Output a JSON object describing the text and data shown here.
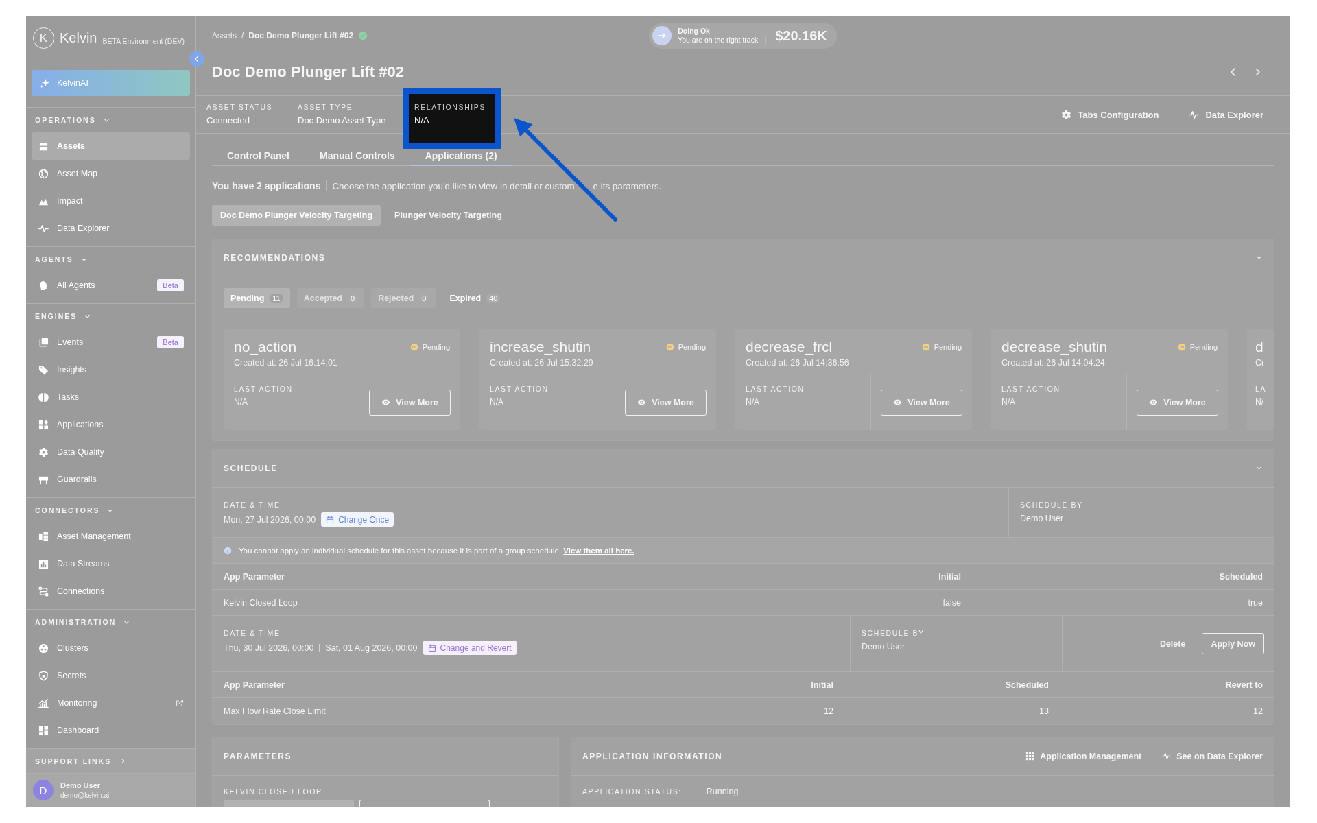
{
  "sidebar": {
    "logo_mark": "K",
    "logo": "Kelvin",
    "environment": "BETA Environment (DEV)",
    "ai_button": "KelvinAI",
    "sections": [
      {
        "title": "OPERATIONS",
        "expanded": true,
        "items": [
          {
            "label": "Assets",
            "selected": true
          },
          {
            "label": "Asset Map",
            "selected": false
          },
          {
            "label": "Impact",
            "selected": false
          },
          {
            "label": "Data Explorer",
            "selected": false
          }
        ]
      },
      {
        "title": "AGENTS",
        "expanded": true,
        "items": [
          {
            "label": "All Agents",
            "selected": false,
            "badge": "Beta"
          }
        ]
      },
      {
        "title": "ENGINES",
        "expanded": true,
        "items": [
          {
            "label": "Events",
            "selected": false,
            "badge": "Beta"
          },
          {
            "label": "Insights",
            "selected": false
          },
          {
            "label": "Tasks",
            "selected": false
          },
          {
            "label": "Applications",
            "selected": false
          },
          {
            "label": "Data Quality",
            "selected": false
          },
          {
            "label": "Guardrails",
            "selected": false
          }
        ]
      },
      {
        "title": "CONNECTORS",
        "expanded": true,
        "items": [
          {
            "label": "Asset Management",
            "selected": false
          },
          {
            "label": "Data Streams",
            "selected": false
          },
          {
            "label": "Connections",
            "selected": false
          }
        ]
      },
      {
        "title": "ADMINISTRATION",
        "expanded": true,
        "items": [
          {
            "label": "Clusters",
            "selected": false
          },
          {
            "label": "Secrets",
            "selected": false
          },
          {
            "label": "Monitoring",
            "selected": false,
            "external": true
          },
          {
            "label": "Dashboard",
            "selected": false
          }
        ]
      }
    ],
    "support_links": {
      "label": "SUPPORT LINKS",
      "expanded": false
    },
    "user": {
      "initial": "D",
      "name": "Demo User",
      "email": "demo@kelvin.ai"
    }
  },
  "header": {
    "breadcrumb": [
      {
        "label": "Assets"
      },
      {
        "label": "Doc Demo Plunger Lift #02"
      }
    ],
    "breadcrumb_separator": "/",
    "status": {
      "title": "Doing Ok",
      "subtitle": "You are on the right track",
      "value": "$20.16K"
    },
    "title": "Doc Demo Plunger Lift #02",
    "info": [
      {
        "label": "ASSET STATUS",
        "value": "Connected",
        "highlighted": false
      },
      {
        "label": "ASSET TYPE",
        "value": "Doc Demo Asset Type",
        "highlighted": false
      },
      {
        "label": "RELATIONSHIPS",
        "value": "N/A",
        "highlighted": true
      }
    ],
    "actions": [
      {
        "label": "Tabs Configuration",
        "kind": "config"
      },
      {
        "label": "Data Explorer",
        "kind": "explorer"
      }
    ],
    "tabs": [
      {
        "label": "Control Panel",
        "selected": false
      },
      {
        "label": "Manual Controls",
        "selected": false
      },
      {
        "label": "Applications (2)",
        "selected": true
      }
    ],
    "summary": "You have 2 applications",
    "hint": [
      "Choose the application you'd like to view in detail or custom",
      "e its parameters."
    ],
    "applications": [
      {
        "label": "Doc Demo Plunger Velocity Targeting",
        "selected": true
      },
      {
        "label": "Plunger Velocity Targeting",
        "selected": false
      }
    ]
  },
  "recommendations": {
    "title": "RECOMMENDATIONS",
    "expanded": true,
    "filters": [
      {
        "label": "Pending",
        "count": "11",
        "selected": true,
        "disabled": false
      },
      {
        "label": "Accepted",
        "count": "0",
        "selected": false,
        "disabled": true
      },
      {
        "label": "Rejected",
        "count": "0",
        "selected": false,
        "disabled": true
      },
      {
        "label": "Expired",
        "count": "40",
        "selected": false,
        "disabled": false
      }
    ],
    "cards": [
      {
        "title": "no_action",
        "status": "Pending",
        "created": "Created at: 26 Jul 16:14:01",
        "last_action_label": "LAST ACTION",
        "last_action": "N/A",
        "button": "View More"
      },
      {
        "title": "increase_shutin",
        "status": "Pending",
        "created": "Created at: 26 Jul 15:32:29",
        "last_action_label": "LAST ACTION",
        "last_action": "N/A",
        "button": "View More"
      },
      {
        "title": "decrease_frcl",
        "status": "Pending",
        "created": "Created at: 26 Jul 14:36:56",
        "last_action_label": "LAST ACTION",
        "last_action": "N/A",
        "button": "View More"
      },
      {
        "title": "decrease_shutin",
        "status": "Pending",
        "created": "Created at: 26 Jul 14:04:24",
        "last_action_label": "LAST ACTION",
        "last_action": "N/A",
        "button": "View More"
      },
      {
        "title": "d",
        "created": "Cr",
        "last_action_label": "LA",
        "last_action": "N/"
      }
    ]
  },
  "schedule": {
    "title": "SCHEDULE",
    "expanded": true,
    "items": [
      {
        "date_label": "DATE & TIME",
        "dates": [
          "Mon, 27 Jul 2026, 00:00"
        ],
        "change_button": {
          "label": "Change Once",
          "kind": "once"
        },
        "by_label": "SCHEDULE BY",
        "by": "Demo User",
        "notice": {
          "text": "You cannot apply an individual schedule for this asset because it is part of a group schedule.",
          "link": "View them all here."
        },
        "table": {
          "columns": [
            "App Parameter",
            "Initial",
            "Scheduled"
          ],
          "rows": [
            [
              "Kelvin Closed Loop",
              "false",
              "true"
            ]
          ]
        }
      },
      {
        "date_label": "DATE & TIME",
        "dates": [
          "Thu, 30 Jul 2026, 00:00",
          "Sat, 01 Aug 2026, 00:00"
        ],
        "change_button": {
          "label": "Change and Revert",
          "kind": "revert"
        },
        "by_label": "SCHEDULE BY",
        "by": "Demo User",
        "actions": [
          {
            "label": "Delete",
            "kind": "delete"
          },
          {
            "label": "Apply Now",
            "kind": "apply"
          }
        ],
        "table": {
          "columns": [
            "App Parameter",
            "Initial",
            "Scheduled",
            "Revert to"
          ],
          "rows": [
            [
              "Max Flow Rate Close Limit",
              "12",
              "13",
              "12"
            ]
          ]
        }
      }
    ]
  },
  "parameters": {
    "title": "PARAMETERS",
    "field_label": "KELVIN CLOSED LOOP"
  },
  "application_information": {
    "title": "APPLICATION INFORMATION",
    "actions": [
      {
        "label": "Application Management",
        "kind": "management"
      },
      {
        "label": "See on Data Explorer",
        "kind": "explorer"
      }
    ],
    "status_label": "APPLICATION STATUS:",
    "status": "Running"
  }
}
